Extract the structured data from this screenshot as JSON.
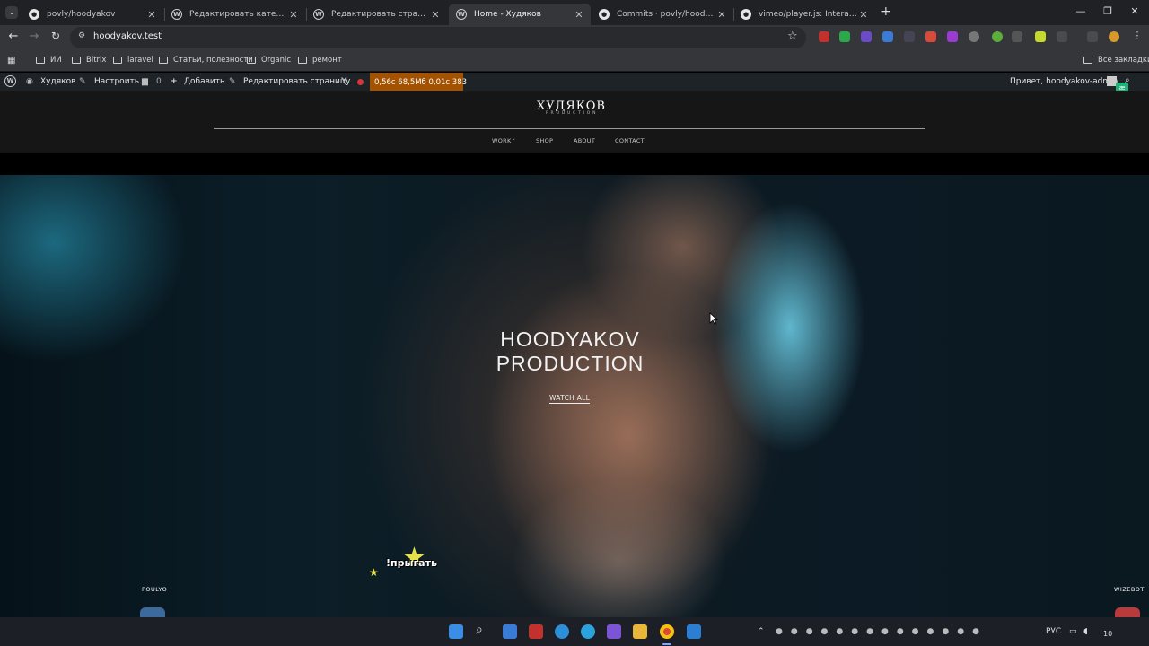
{
  "browser": {
    "tabs": [
      {
        "label": "povly/hoodyakov",
        "icon": "github-icon",
        "active": false
      },
      {
        "label": "Редактировать категорию вид",
        "icon": "wordpress-icon",
        "active": false
      },
      {
        "label": "Редактировать страницу “Hom",
        "icon": "wordpress-icon",
        "active": false
      },
      {
        "label": "Home - Худяков",
        "icon": "wordpress-icon",
        "active": true
      },
      {
        "label": "Commits · povly/hoodyakov",
        "icon": "github-icon",
        "active": false
      },
      {
        "label": "vimeo/player.js: Interact with an",
        "icon": "github-icon",
        "active": false
      }
    ],
    "url": "hoodyakov.test",
    "bookmarks": [
      {
        "label": "ИИ",
        "icon": "folder-icon"
      },
      {
        "label": "Bitrix",
        "icon": "folder-icon"
      },
      {
        "label": "laravel",
        "icon": "folder-icon"
      },
      {
        "label": "Статьи, полезности",
        "icon": "folder-icon"
      },
      {
        "label": "Organic",
        "icon": "folder-icon"
      },
      {
        "label": "ремонт",
        "icon": "folder-icon"
      }
    ],
    "all_bookmarks": "Все закладки"
  },
  "adminbar": {
    "site_name": "Худяков",
    "customize": "Настроить",
    "comments_count": "0",
    "add_new": "Добавить",
    "edit_page": "Редактировать страницу",
    "query_monitor": "0,56с  68,5Мб  0,01с  383",
    "greeting": "Привет, hoodyakov-admin"
  },
  "site": {
    "logo": "ХУДЯКОВ",
    "logo_sub": "PRODUCTION",
    "nav": [
      "WORK",
      "SHOP",
      "ABOUT",
      "CONTACT"
    ]
  },
  "hero": {
    "title": "HOODYAKOV\nPRODUCTION",
    "cta": "WATCH ALL"
  },
  "overlay": {
    "jump_text": "!прыгать",
    "left_name": "POULYO",
    "right_name": "WIZEBOT"
  },
  "taskbar": {
    "lang": "РУС",
    "time": "10"
  },
  "colors": {
    "admin_bar": "#1d2327",
    "query_monitor": "#a35200",
    "site_header": "#161616"
  }
}
